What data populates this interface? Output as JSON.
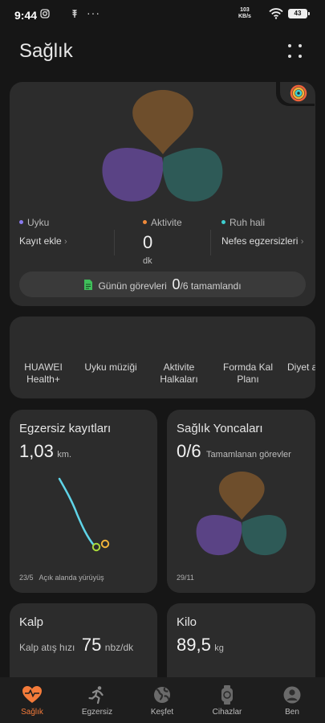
{
  "status_bar": {
    "time": "9:44",
    "speed_value": "103",
    "speed_unit": "KB/s",
    "battery": "43"
  },
  "header": {
    "title": "Sağlık",
    "menu_icon": "grid-dots-icon"
  },
  "summary": {
    "sleep": {
      "label": "Uyku",
      "value": "Kayıt ekle",
      "color": "#8a7bf0"
    },
    "activity": {
      "label": "Aktivite",
      "value": "0",
      "unit": "dk",
      "color": "#f08a3a"
    },
    "mood": {
      "label": "Ruh hali",
      "value": "Nefes egzersizleri",
      "color": "#3ecfd0"
    },
    "tasks": {
      "prefix": "Günün görevleri",
      "count": "0",
      "total": "/6 tamamlandı"
    }
  },
  "shortcuts": [
    {
      "label": "HUAWEI Health+"
    },
    {
      "label": "Uyku müziği"
    },
    {
      "label": "Aktivite Halkaları"
    },
    {
      "label": "Formda Kal Planı"
    },
    {
      "label": "Diyet a"
    }
  ],
  "exercise": {
    "title": "Egzersiz kayıtları",
    "value": "1,03",
    "unit": "km.",
    "date": "23/5",
    "type": "Açık alanda yürüyüş",
    "route_color": "#5fd4e8"
  },
  "clovers": {
    "title": "Sağlık Yoncaları",
    "value": "0/6",
    "label": "Tamamlanan görevler",
    "date": "29/11"
  },
  "heart": {
    "title": "Kalp",
    "label": "Kalp atış hızı",
    "value": "75",
    "unit": "nbz/dk"
  },
  "weight": {
    "title": "Kilo",
    "value": "89,5",
    "unit": "kg"
  },
  "nav": [
    {
      "label": "Sağlık",
      "icon": "heart-pulse-icon",
      "active": true
    },
    {
      "label": "Egzersiz",
      "icon": "runner-icon",
      "active": false
    },
    {
      "label": "Keşfet",
      "icon": "globe-icon",
      "active": false
    },
    {
      "label": "Cihazlar",
      "icon": "watch-icon",
      "active": false
    },
    {
      "label": "Ben",
      "icon": "user-icon",
      "active": false
    }
  ],
  "colors": {
    "accent": "#f47b3a",
    "clover_top": "#6e4e2c",
    "clover_left": "#5a4385",
    "clover_right": "#2e5a57"
  }
}
